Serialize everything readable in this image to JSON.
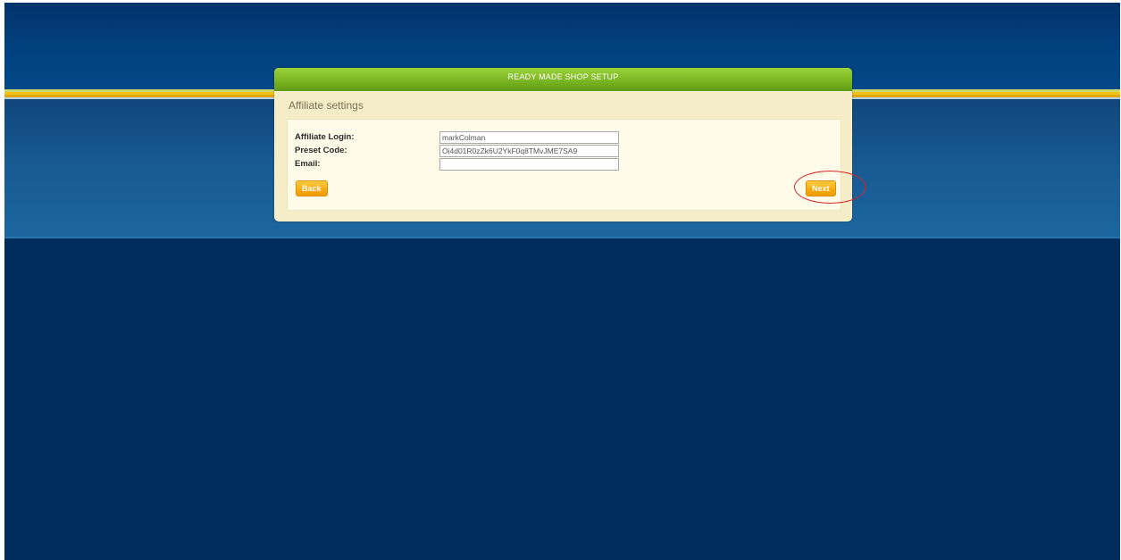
{
  "dialog": {
    "title": "READY MADE SHOP SETUP",
    "section_title": "Affiliate settings"
  },
  "form": {
    "affiliate_login": {
      "label": "Affiliate Login:",
      "value": "markColman"
    },
    "preset_code": {
      "label": "Preset Code:",
      "value": "Oi4d01R0zZk6U2YkF0q8TMvJME7SA9"
    },
    "email": {
      "label": "Email:",
      "value": ""
    }
  },
  "buttons": {
    "back_label": "Back",
    "next_label": "Next"
  },
  "colors": {
    "page_background": "#012d5c",
    "header_green": "#7bb623",
    "button_orange": "#f7a90f",
    "highlight_red": "#d9232a"
  }
}
